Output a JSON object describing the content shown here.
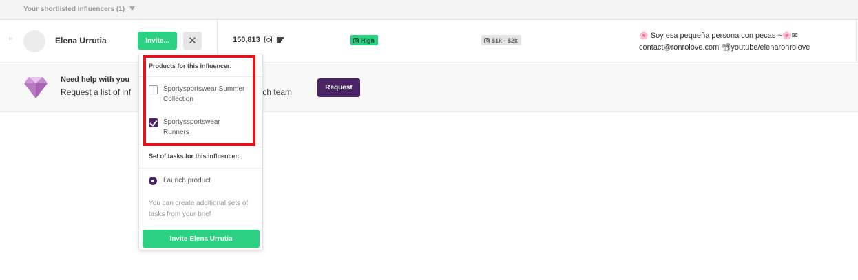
{
  "section": {
    "title": "Your shortlisted influencers (1)"
  },
  "influencer": {
    "name": "Elena Urrutia",
    "invite_label": "Invite...",
    "close_label": "✕",
    "expand_label": "+",
    "followers": "150,813",
    "engagement_badge": "High",
    "price_badge": "$1k - $2k",
    "bio_line1": "🌸 Soy esa pequeña persona con pecas ~🌸✉",
    "bio_line2": "contact@ronrolove.com 📽youtube/elenaronrolove"
  },
  "help": {
    "title": "Need help with you",
    "text": "Request a list of inf",
    "text_tail": "unch team",
    "request_label": "Request"
  },
  "dropdown": {
    "products_heading": "Products for this influencer:",
    "products": [
      {
        "label": "Sportysportswear Summer Collection",
        "checked": false
      },
      {
        "label": "Sportyssportswear Runners",
        "checked": true
      }
    ],
    "tasks_heading": "Set of tasks for this influencer:",
    "task_option": "Launch product",
    "note": "You can create additional sets of tasks from your brief",
    "invite_button": "Invite Elena Urrutia"
  },
  "colors": {
    "accent_green": "#2bd180",
    "brand_purple": "#4a2364",
    "highlight_red": "#e4141b"
  },
  "icons": {
    "instagram": "instagram-icon",
    "list": "list-icon",
    "gem": "gem-icon",
    "caret": "caret-down-icon"
  }
}
